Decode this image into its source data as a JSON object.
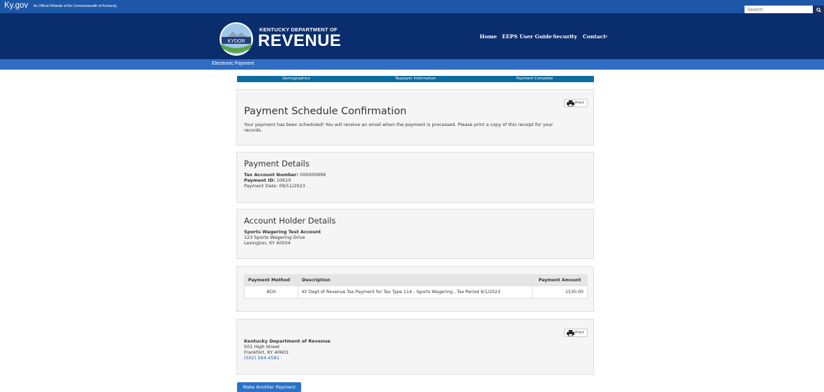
{
  "topbar": {
    "site": "Ky.gov",
    "official": "An Official Website of the Commonwealth of Kentucky",
    "search_placeholder": "Search",
    "search_icon": "search-icon"
  },
  "header": {
    "logo_text": "KYDOR",
    "brand_top": "KENTUCKY DEPARTMENT OF",
    "brand_main": "REVENUE",
    "nav": [
      "Home",
      "EEPS User Guide",
      "Security",
      "Contact"
    ],
    "contact_caret": "▾"
  },
  "subbar": {
    "title": "Electronic Payment"
  },
  "steps": [
    "Demographics",
    "Taxpayer Information",
    "Payment Complete"
  ],
  "confirmation": {
    "title": "Payment Schedule Confirmation",
    "message_line1": "Your payment has been scheduled! You will receive an email when the payment is processed. Please print a copy of this receipt for your",
    "message_line2": "records.",
    "print_label": "Print"
  },
  "payment_details": {
    "title": "Payment Details",
    "tax_account_label": "Tax Account Number:",
    "tax_account_value": "000000999",
    "payment_id_label": "Payment ID:",
    "payment_id_value": "10610",
    "payment_date": "Payment Date: 09/11/2023"
  },
  "account_holder": {
    "title": "Account Holder Details",
    "name": "Sports Wagering Test Account",
    "address1": "123 Sports Wagering Drive",
    "address2": "Lexington, KY 40504"
  },
  "payment_table": {
    "headers": [
      "Payment Method",
      "Description",
      "Payment Amount"
    ],
    "rows": [
      [
        "ACH",
        "KY Dept of Revenue Tax Payment for Tax Type 114 - Sports Wagering , Tax Period 9/1/2023",
        "1530.00"
      ]
    ]
  },
  "footer_panel": {
    "print_label": "Print",
    "org": "Kentucky Department of Revenue",
    "street": "501 High Street",
    "city": "Frankfort, KY 40601",
    "phone": "(502) 564-4581"
  },
  "actions": {
    "make_another": "Make Another Payment"
  },
  "colors": {
    "topbar": "#1c57a8",
    "header": "#0a2d6e",
    "subbar": "#2f6dc2",
    "steps": "#0d6c9e",
    "button": "#2a72c7"
  }
}
